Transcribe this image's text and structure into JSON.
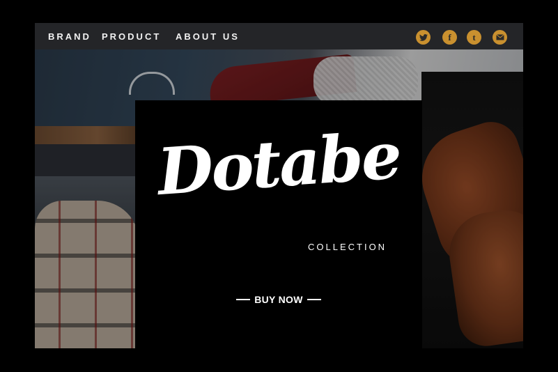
{
  "nav": {
    "links": [
      "BRAND",
      "PRODUCT",
      "ABOUT US"
    ]
  },
  "social": {
    "color": "#c9902f",
    "icons": [
      "twitter-icon",
      "facebook-icon",
      "tumblr-icon",
      "mail-icon"
    ],
    "facebook_glyph": "f",
    "tumblr_glyph": "t"
  },
  "hero": {
    "logo": "Dotabe",
    "subtitle": "COLLECTION",
    "cta": "BUY NOW"
  }
}
